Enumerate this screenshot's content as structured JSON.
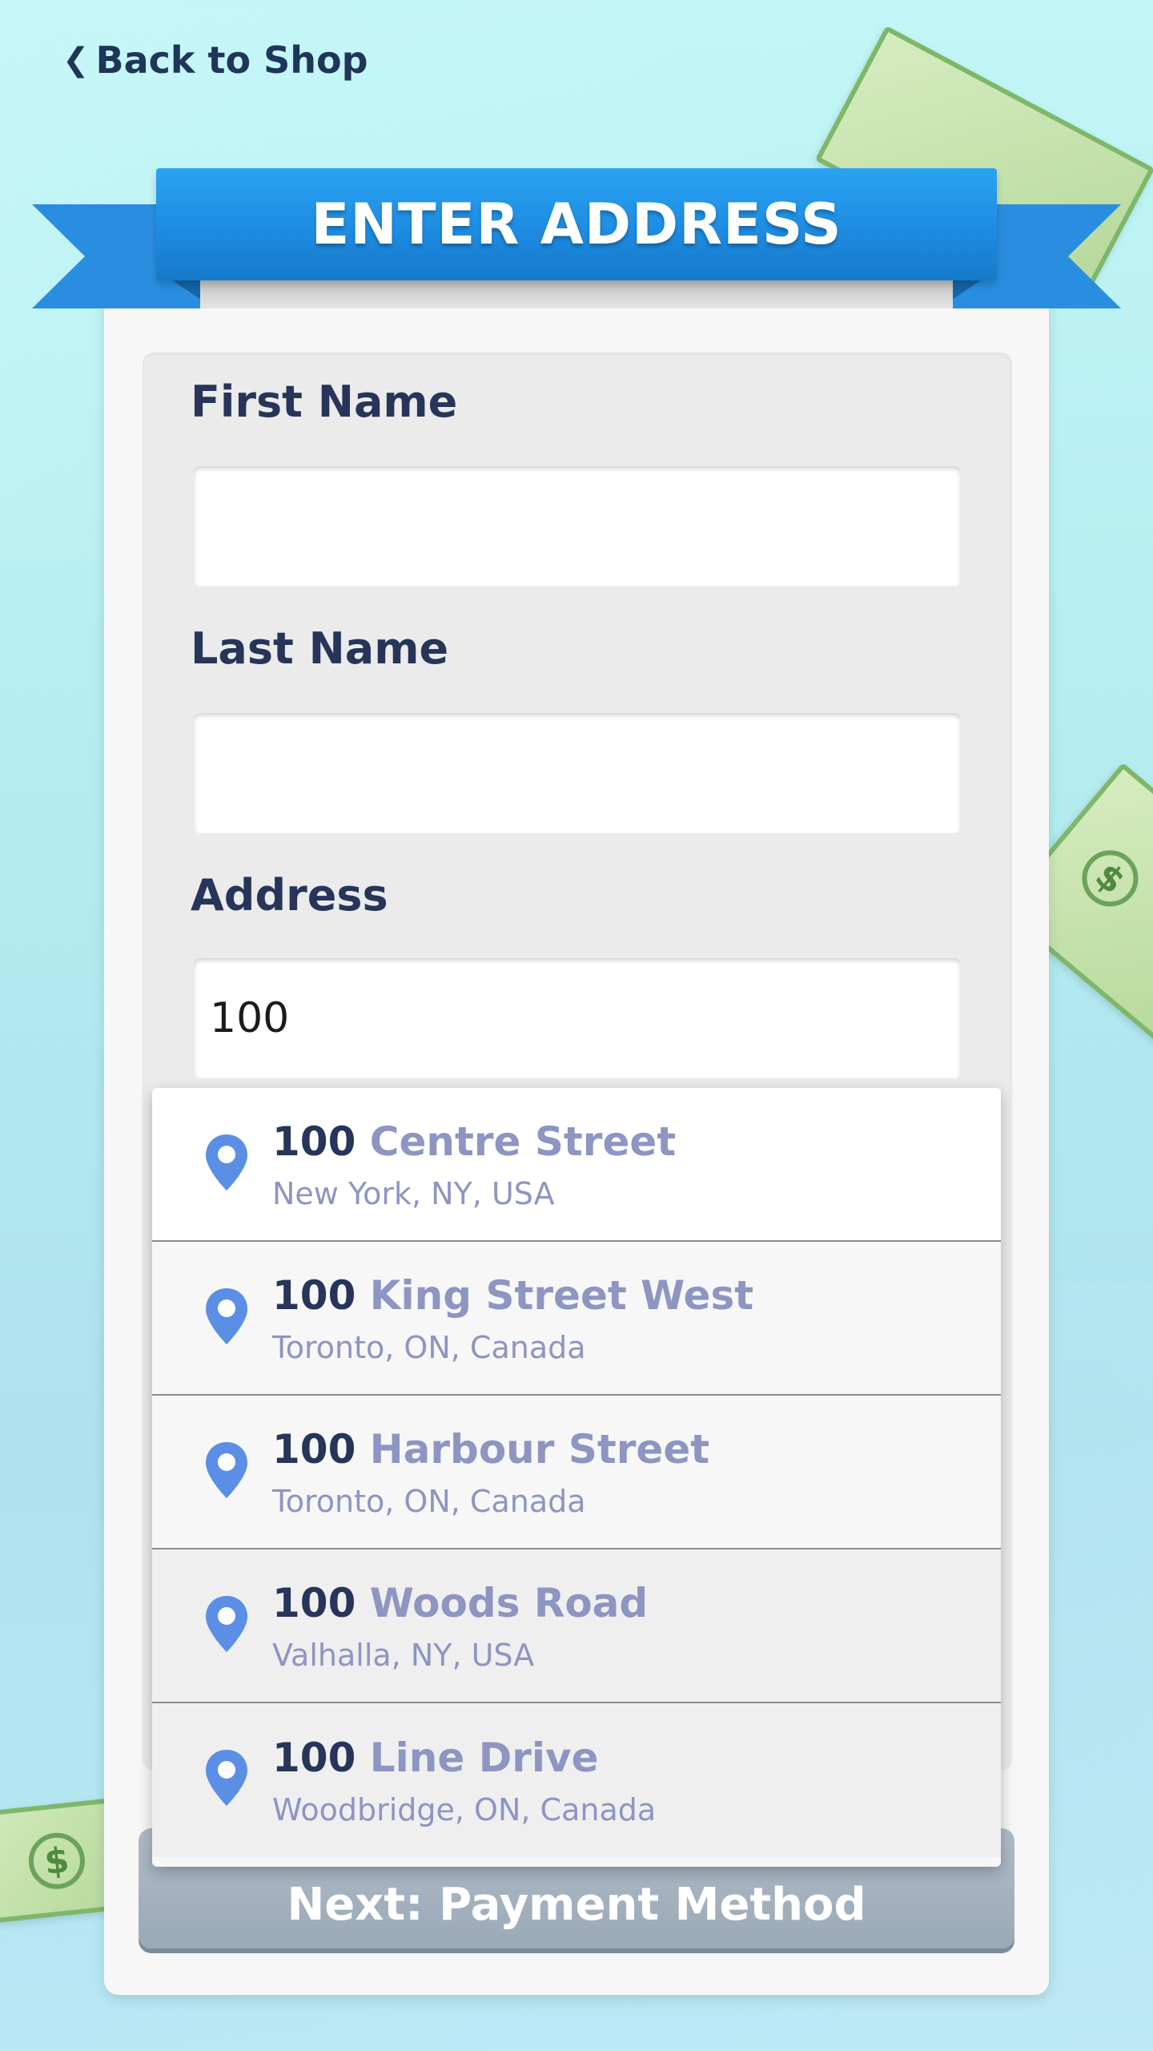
{
  "back_link": {
    "label": "Back to Shop"
  },
  "banner": {
    "title": "ENTER ADDRESS"
  },
  "form": {
    "first_name": {
      "label": "First Name",
      "value": ""
    },
    "last_name": {
      "label": "Last Name",
      "value": ""
    },
    "address": {
      "label": "Address",
      "value": "100"
    }
  },
  "suggestions": [
    {
      "number": "100",
      "street": "Centre Street",
      "locality": "New York, NY, USA"
    },
    {
      "number": "100",
      "street": "King Street West",
      "locality": "Toronto, ON, Canada"
    },
    {
      "number": "100",
      "street": "Harbour Street",
      "locality": "Toronto, ON, Canada"
    },
    {
      "number": "100",
      "street": "Woods Road",
      "locality": "Valhalla, NY, USA"
    },
    {
      "number": "100",
      "street": "Line Drive",
      "locality": "Woodbridge, ON, Canada"
    }
  ],
  "next_button": {
    "label": "Next: Payment Method"
  },
  "colors": {
    "ribbon": "#1d8ae0",
    "label_text": "#263559",
    "pin": "#5b8fe6",
    "suggestion_secondary": "#8d95c2"
  },
  "icons": {
    "back": "chevron-left-icon",
    "pin": "map-pin-icon",
    "bill": "dollar-bill-icon"
  }
}
